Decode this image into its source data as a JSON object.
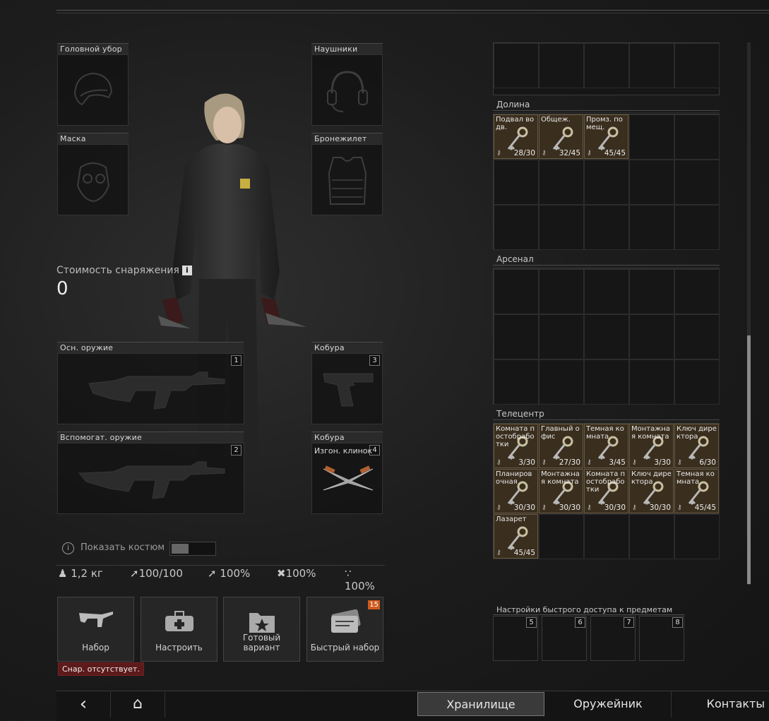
{
  "slots": {
    "headwear": "Головной убор",
    "earpiece": "Наушники",
    "face_cover": "Маска",
    "armor": "Бронежилет",
    "primary": {
      "label": "Осн. оружие",
      "num": "1"
    },
    "holster": {
      "label": "Кобура",
      "num": "3"
    },
    "secondary": {
      "label": "Вспомогат. оружие",
      "num": "2"
    },
    "scabbard": {
      "label": "Кобура",
      "num": "4",
      "item": "Изгон. клинок"
    }
  },
  "gear_value": {
    "label": "Стоимость снаряжения",
    "info": "i",
    "value": "0"
  },
  "costume": {
    "label": "Показать костюм"
  },
  "stats": {
    "weight": "1,2 кг",
    "energy": "100/100",
    "stat2": "100%",
    "stat3": "100%",
    "stat4": "100%"
  },
  "buttons": [
    {
      "label": "Набор"
    },
    {
      "label": "Настроить"
    },
    {
      "label": "Готовый вариант"
    },
    {
      "label": "Быстрый набор",
      "badge": "15"
    }
  ],
  "warning": "Снар. отсутствует.",
  "sections": [
    {
      "title": "Долина",
      "items": [
        {
          "name": "Подвал во дв.",
          "count": "28/30"
        },
        {
          "name": "Общеж.",
          "count": "32/45"
        },
        {
          "name": "Промз. помещ.",
          "count": "45/45"
        }
      ]
    },
    {
      "title": "Арсенал",
      "items": []
    },
    {
      "title": "Телецентр",
      "items": [
        {
          "name": "Комната постобработки",
          "count": "3/30"
        },
        {
          "name": "Главный офис",
          "count": "27/30"
        },
        {
          "name": "Темная комната",
          "count": "3/45"
        },
        {
          "name": "Монтажная комната",
          "count": "3/30"
        },
        {
          "name": "Ключ директора",
          "count": "6/30"
        },
        {
          "name": "Планировочная",
          "count": "30/30"
        },
        {
          "name": "Монтажная комната",
          "count": "30/30"
        },
        {
          "name": "Комната постобработки",
          "count": "30/30"
        },
        {
          "name": "Ключ директора",
          "count": "30/30"
        },
        {
          "name": "Темная комната",
          "count": "45/45"
        },
        {
          "name": "Лазарет",
          "count": "45/45"
        }
      ]
    }
  ],
  "quick_access": {
    "title": "Настройки быстрого доступа к предметам",
    "slots": [
      "5",
      "6",
      "7",
      "8"
    ]
  },
  "nav": {
    "back": "‹",
    "home": "⌂",
    "storage": "Хранилище",
    "gunsmith": "Оружейник",
    "contacts": "Контакты"
  }
}
